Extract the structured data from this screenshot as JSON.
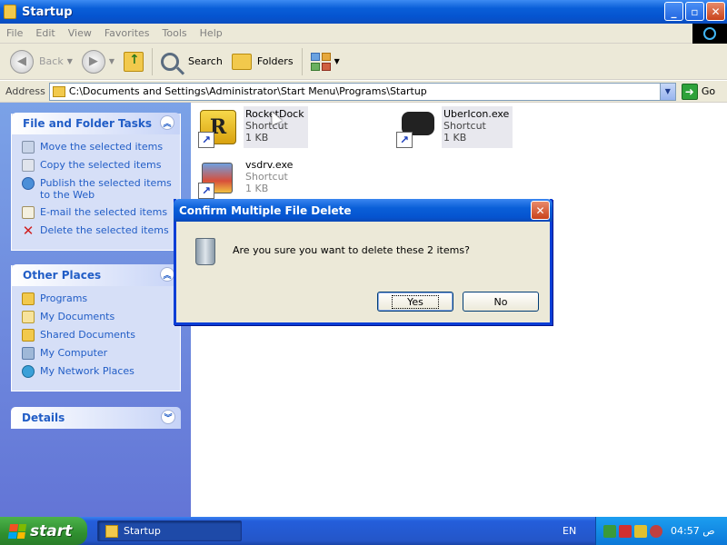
{
  "window": {
    "title": "Startup",
    "buttons": {
      "minimize": "_",
      "maximize": "▫",
      "close": "✕"
    }
  },
  "menu": [
    "File",
    "Edit",
    "View",
    "Favorites",
    "Tools",
    "Help"
  ],
  "toolbar": {
    "back_label": "Back",
    "search_label": "Search",
    "folders_label": "Folders"
  },
  "address": {
    "label": "Address",
    "path": "C:\\Documents and Settings\\Administrator\\Start Menu\\Programs\\Startup",
    "go_label": "Go"
  },
  "tasks": {
    "file_folder": {
      "title": "File and Folder Tasks",
      "items": [
        "Move the selected items",
        "Copy the selected items",
        "Publish the selected items to the Web",
        "E-mail the selected items",
        "Delete the selected items"
      ]
    },
    "other_places": {
      "title": "Other Places",
      "items": [
        "Programs",
        "My Documents",
        "Shared Documents",
        "My Computer",
        "My Network Places"
      ]
    },
    "details": {
      "title": "Details"
    }
  },
  "files": [
    {
      "name": "RocketDock",
      "type": "Shortcut",
      "size": "1 KB"
    },
    {
      "name": "UberIcon.exe",
      "type": "Shortcut",
      "size": "1 KB"
    },
    {
      "name": "vsdrv.exe",
      "type": "Shortcut",
      "size": "1 KB"
    }
  ],
  "dialog": {
    "title": "Confirm Multiple File Delete",
    "message": "Are you sure you want to delete these 2 items?",
    "yes_label": "Yes",
    "no_label": "No"
  },
  "taskbar": {
    "start_label": "start",
    "task_label": "Startup",
    "language": "EN",
    "clock": "04:57 ص"
  }
}
